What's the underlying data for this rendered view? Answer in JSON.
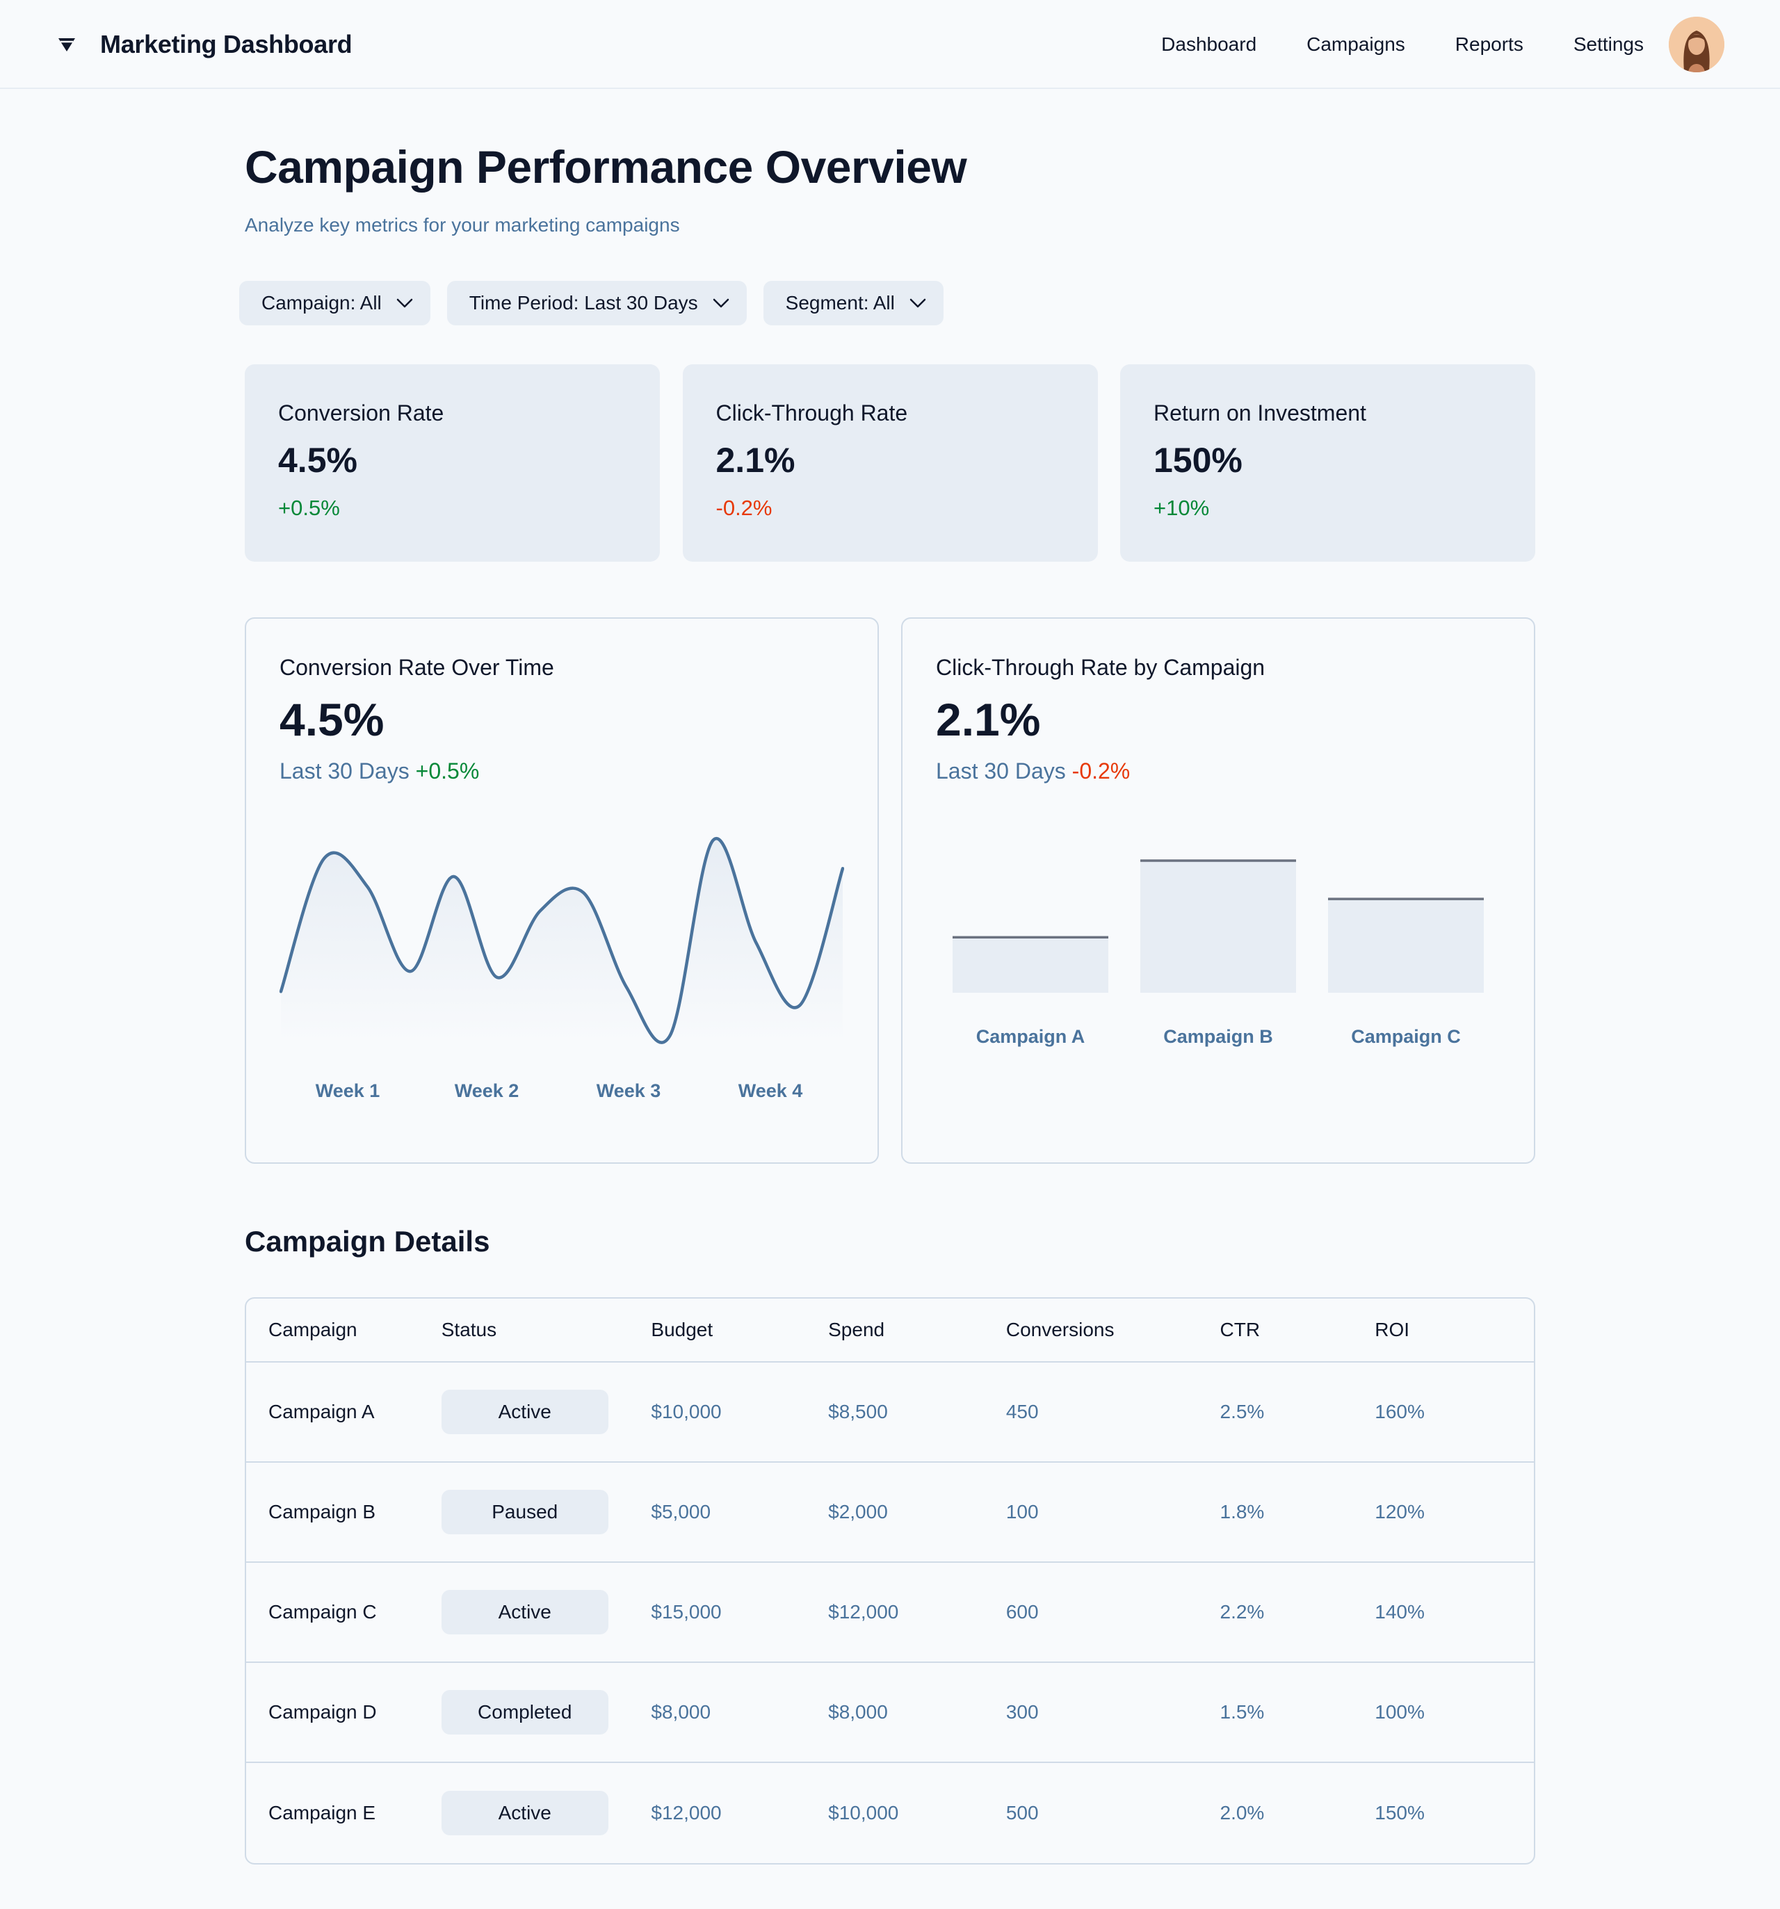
{
  "header": {
    "title": "Marketing Dashboard",
    "nav": [
      "Dashboard",
      "Campaigns",
      "Reports",
      "Settings"
    ]
  },
  "page": {
    "title": "Campaign Performance Overview",
    "subtitle": "Analyze key metrics for your marketing campaigns"
  },
  "filters": [
    "Campaign: All",
    "Time Period: Last 30 Days",
    "Segment: All"
  ],
  "stats": [
    {
      "label": "Conversion Rate",
      "value": "4.5%",
      "delta": "+0.5%",
      "trend": "positive"
    },
    {
      "label": "Click-Through Rate",
      "value": "2.1%",
      "delta": "-0.2%",
      "trend": "negative"
    },
    {
      "label": "Return on Investment",
      "value": "150%",
      "delta": "+10%",
      "trend": "positive"
    }
  ],
  "charts": {
    "conversion": {
      "title": "Conversion Rate Over Time",
      "value": "4.5%",
      "period": "Last 30 Days",
      "delta": "+0.5%"
    },
    "ctr": {
      "title": "Click-Through Rate by Campaign",
      "value": "2.1%",
      "period": "Last 30 Days",
      "delta": "-0.2%"
    }
  },
  "chart_data": [
    {
      "type": "area",
      "title": "",
      "xlabel": "",
      "ylabel": "",
      "x_ticks": [
        "Week 1",
        "Week 2",
        "Week 3",
        "Week 4"
      ],
      "values": [
        0.22,
        0.88,
        0.74,
        0.32,
        0.79,
        0.29,
        0.62,
        0.71,
        0.24,
        0.0,
        0.97,
        0.46,
        0.15,
        0.83
      ],
      "y_axis_visible": false,
      "grid": false,
      "colors": {
        "line": "#4a739c",
        "fill_top": "#e7edf4",
        "fill_bottom": "#f8fafc"
      }
    },
    {
      "type": "bar",
      "title": "",
      "categories": [
        "Campaign A",
        "Campaign B",
        "Campaign C"
      ],
      "values": [
        0.42,
        1.0,
        0.71
      ],
      "y_axis_visible": false,
      "grid": false,
      "colors": {
        "bar": "#e7edf4",
        "top_line": "#6b7280"
      }
    }
  ],
  "table": {
    "title": "Campaign Details",
    "columns": [
      "Campaign",
      "Status",
      "Budget",
      "Spend",
      "Conversions",
      "CTR",
      "ROI"
    ],
    "rows": [
      {
        "campaign": "Campaign A",
        "status": "Active",
        "budget": "$10,000",
        "spend": "$8,500",
        "conversions": "450",
        "ctr": "2.5%",
        "roi": "160%"
      },
      {
        "campaign": "Campaign B",
        "status": "Paused",
        "budget": "$5,000",
        "spend": "$2,000",
        "conversions": "100",
        "ctr": "1.8%",
        "roi": "120%"
      },
      {
        "campaign": "Campaign C",
        "status": "Active",
        "budget": "$15,000",
        "spend": "$12,000",
        "conversions": "600",
        "ctr": "2.2%",
        "roi": "140%"
      },
      {
        "campaign": "Campaign D",
        "status": "Completed",
        "budget": "$8,000",
        "spend": "$8,000",
        "conversions": "300",
        "ctr": "1.5%",
        "roi": "100%"
      },
      {
        "campaign": "Campaign E",
        "status": "Active",
        "budget": "$12,000",
        "spend": "$10,000",
        "conversions": "500",
        "ctr": "2.0%",
        "roi": "150%"
      }
    ]
  },
  "icons": {
    "brand": "logo-icon",
    "chevron": "chevron-down-icon",
    "avatar": "user-avatar"
  },
  "colors": {
    "accent": "#4a739c",
    "positive": "#078838",
    "negative": "#e73908",
    "surface": "#e7edf4",
    "border": "#d0dbe7",
    "background": "#f8fafc"
  }
}
